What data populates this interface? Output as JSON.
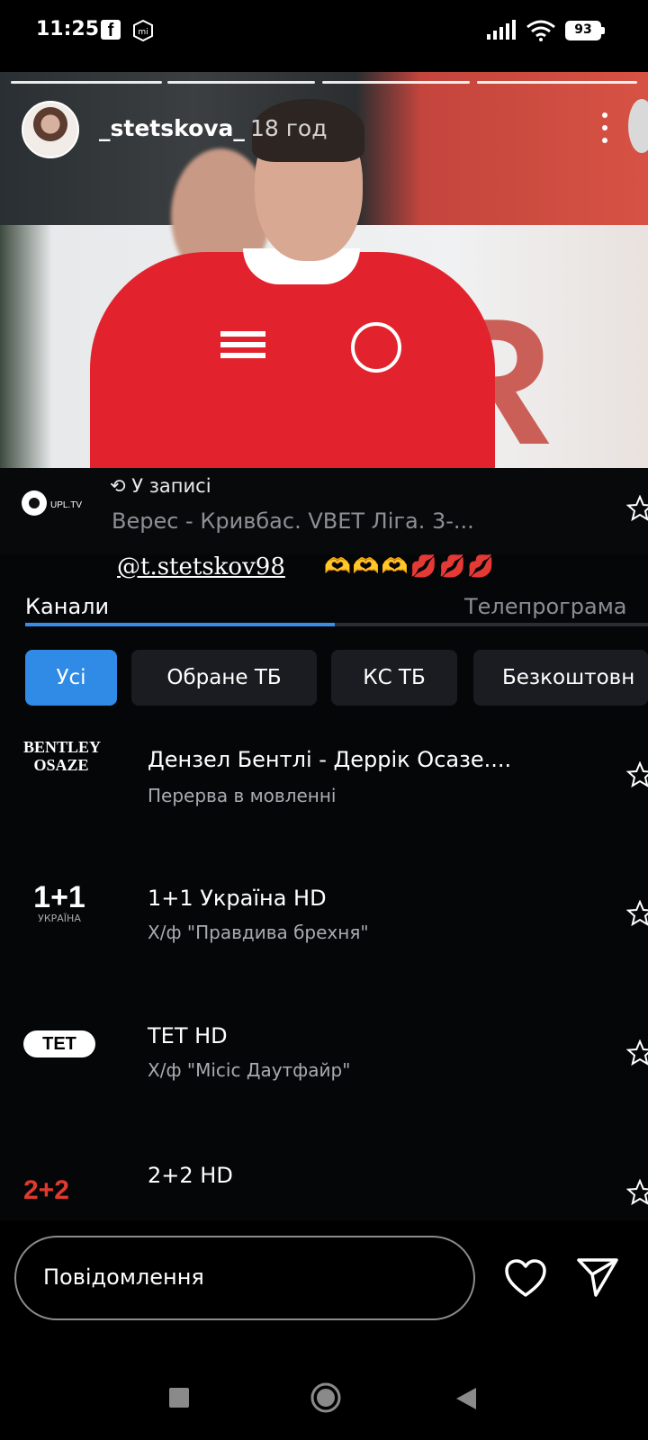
{
  "status_bar": {
    "time": "11:25",
    "battery": "93",
    "icons": [
      "facebook-icon",
      "mi-icon",
      "signal-icon",
      "wifi-icon",
      "battery-icon"
    ]
  },
  "story": {
    "username": "_stetskova_",
    "time_ago": "18 год",
    "progress_segments": 4,
    "mention": "@t.stetskov98",
    "emojis": "🫶🫶🫶💋💋💋"
  },
  "tv_app": {
    "live_label": "У записі",
    "live_title": "Верес - Кривбас. VBET Ліга. 3-...",
    "live_channel_logo_text": "UPL.TV",
    "tabs": [
      "Канали",
      "Телепрограма"
    ],
    "chips": [
      "Усі",
      "Обране ТБ",
      "КС ТБ",
      "Безкоштовн"
    ],
    "channels": [
      {
        "logo": "BENTLEY\nOSAZE",
        "logo_line1": "BENTLEY",
        "logo_line2": "OSAZE",
        "name": "Дензел Бентлі - Деррік Осазе....",
        "program": "Перерва в мовленні"
      },
      {
        "logo_line1": "1+1",
        "logo_line2": "УКРАЇНА",
        "name": "1+1 Україна HD",
        "program": "Х/ф \"Правдива брехня\""
      },
      {
        "logo_line1": "ТЕТ",
        "name": "TET HD",
        "program": "Х/ф \"Місіс Даутфайр\""
      },
      {
        "logo_line1": "2+2",
        "name": "2+2 HD",
        "program": ""
      }
    ]
  },
  "message_bar": {
    "placeholder": "Повідомлення"
  },
  "colors": {
    "accent": "#2f8be6",
    "background": "#000000",
    "shirt_red": "#e2232d"
  }
}
